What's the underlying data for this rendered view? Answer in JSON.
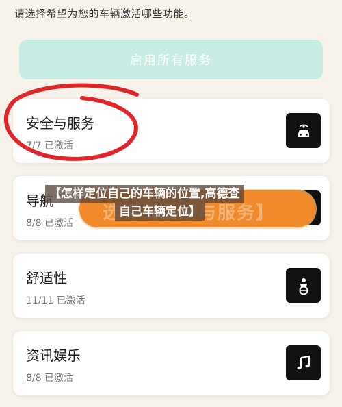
{
  "intro_text": "请选择希望为您的车辆激活哪些功能。",
  "enable_all_label": "启用所有服务",
  "cards": [
    {
      "title": "安全与服务",
      "status": "7/7 已激活",
      "icon": "car-front-icon"
    },
    {
      "title": "导航",
      "status": "8/8 已激活",
      "icon": "navigation-icon"
    },
    {
      "title": "舒适性",
      "status": "11/11 已激活",
      "icon": "seat-comfort-icon"
    },
    {
      "title": "资讯娱乐",
      "status": "8/8 已激活",
      "icon": "music-note-icon"
    }
  ],
  "overlay": {
    "banner_line1": "【怎样定位自己的车辆的位置,高德查",
    "banner_line2": "自己车辆定位】",
    "orange_button_text": "选择【启用与服务】"
  },
  "colors": {
    "background": "#f7f2ea",
    "enable_all_bg": "#c6ece4",
    "icon_bg": "#111111",
    "annotation_red": "#e0262b",
    "orange": "#f08a2a"
  }
}
